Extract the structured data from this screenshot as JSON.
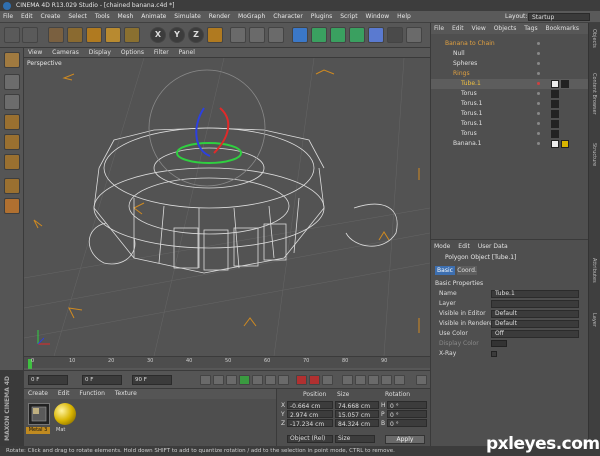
{
  "window": {
    "title": "CINEMA 4D R13.029 Studio - [chained banana.c4d *]"
  },
  "menubar": {
    "items": [
      "File",
      "Edit",
      "Create",
      "Select",
      "Tools",
      "Mesh",
      "Animate",
      "Simulate",
      "Render",
      "MoGraph",
      "Character",
      "Plugins",
      "Script",
      "Window",
      "Help"
    ],
    "layout_label": "Layout:",
    "layout_value": "Startup"
  },
  "toolbar": {
    "axes": [
      "X",
      "Y",
      "Z"
    ]
  },
  "viewport": {
    "menu": [
      "View",
      "Cameras",
      "Display",
      "Options",
      "Filter",
      "Panel"
    ],
    "label": "Perspective"
  },
  "timeline": {
    "ticks": [
      "0",
      "10",
      "20",
      "30",
      "40",
      "50",
      "60",
      "70",
      "80",
      "90"
    ],
    "frame_unit": "0 F",
    "start_frame": "0 F",
    "end_frame": "90 F",
    "end_frame_2": "90 F"
  },
  "materials": {
    "menu": [
      "Create",
      "Edit",
      "Function",
      "Texture"
    ],
    "swatches": [
      {
        "label": "Metal 3",
        "color": "#2a2a2a"
      },
      {
        "label": "Mat",
        "color": "#d8b400"
      }
    ]
  },
  "coordinates": {
    "headers": [
      "Position",
      "Size",
      "Rotation"
    ],
    "rows": [
      {
        "axis": "X",
        "pos": "-0.664 cm",
        "size": "74.668 cm",
        "rot_axis": "H",
        "rot": "0 °"
      },
      {
        "axis": "Y",
        "pos": "2.974 cm",
        "size": "15.057 cm",
        "rot_axis": "P",
        "rot": "0 °"
      },
      {
        "axis": "Z",
        "pos": "-17.234 cm",
        "size": "84.324 cm",
        "rot_axis": "B",
        "rot": "0 °"
      }
    ],
    "mode_select": "Object (Rel)",
    "size_select": "Size",
    "apply_label": "Apply"
  },
  "objects": {
    "menu": [
      "File",
      "Edit",
      "View",
      "Objects",
      "Tags",
      "Bookmarks"
    ],
    "tree": [
      {
        "name": "Banana to Chain",
        "indent": 0,
        "color": "#e0a040"
      },
      {
        "name": "Null",
        "indent": 1,
        "color": "#e0e0e0"
      },
      {
        "name": "Spheres",
        "indent": 1,
        "color": "#e0e0e0"
      },
      {
        "name": "Rings",
        "indent": 1,
        "color": "#e0a040"
      },
      {
        "name": "Tube.1",
        "indent": 2,
        "color": "#e8c060"
      },
      {
        "name": "Torus",
        "indent": 2,
        "color": "#e0e0e0"
      },
      {
        "name": "Torus.1",
        "indent": 2,
        "color": "#e0e0e0"
      },
      {
        "name": "Torus.1",
        "indent": 2,
        "color": "#e0e0e0"
      },
      {
        "name": "Torus.1",
        "indent": 2,
        "color": "#e0e0e0"
      },
      {
        "name": "Torus",
        "indent": 2,
        "color": "#e0e0e0"
      },
      {
        "name": "Banana.1",
        "indent": 1,
        "color": "#e0e0e0"
      }
    ]
  },
  "attributes": {
    "menu": [
      "Mode",
      "Edit",
      "User Data"
    ],
    "object_title": "Polygon Object [Tube.1]",
    "tabs": [
      "Basic",
      "Coord."
    ],
    "section": "Basic Properties",
    "fields": [
      {
        "key": "Name",
        "value": "Tube.1"
      },
      {
        "key": "Layer",
        "value": ""
      },
      {
        "key": "Visible in Editor",
        "value": "Default"
      },
      {
        "key": "Visible in Renderer",
        "value": "Default"
      },
      {
        "key": "Use Color",
        "value": "Off"
      },
      {
        "key": "Display Color",
        "value": ""
      },
      {
        "key": "X-Ray",
        "value": ""
      }
    ]
  },
  "right_tabs": [
    "Objects",
    "Content Browser",
    "Structure",
    "Attributes",
    "Layer"
  ],
  "brand": "MAXON CINEMA 4D",
  "status": "Rotate: Click and drag to rotate elements. Hold down SHIFT to add to quantize rotation / add to the selection in point mode, CTRL to remove.",
  "watermark": "pxleyes.com"
}
